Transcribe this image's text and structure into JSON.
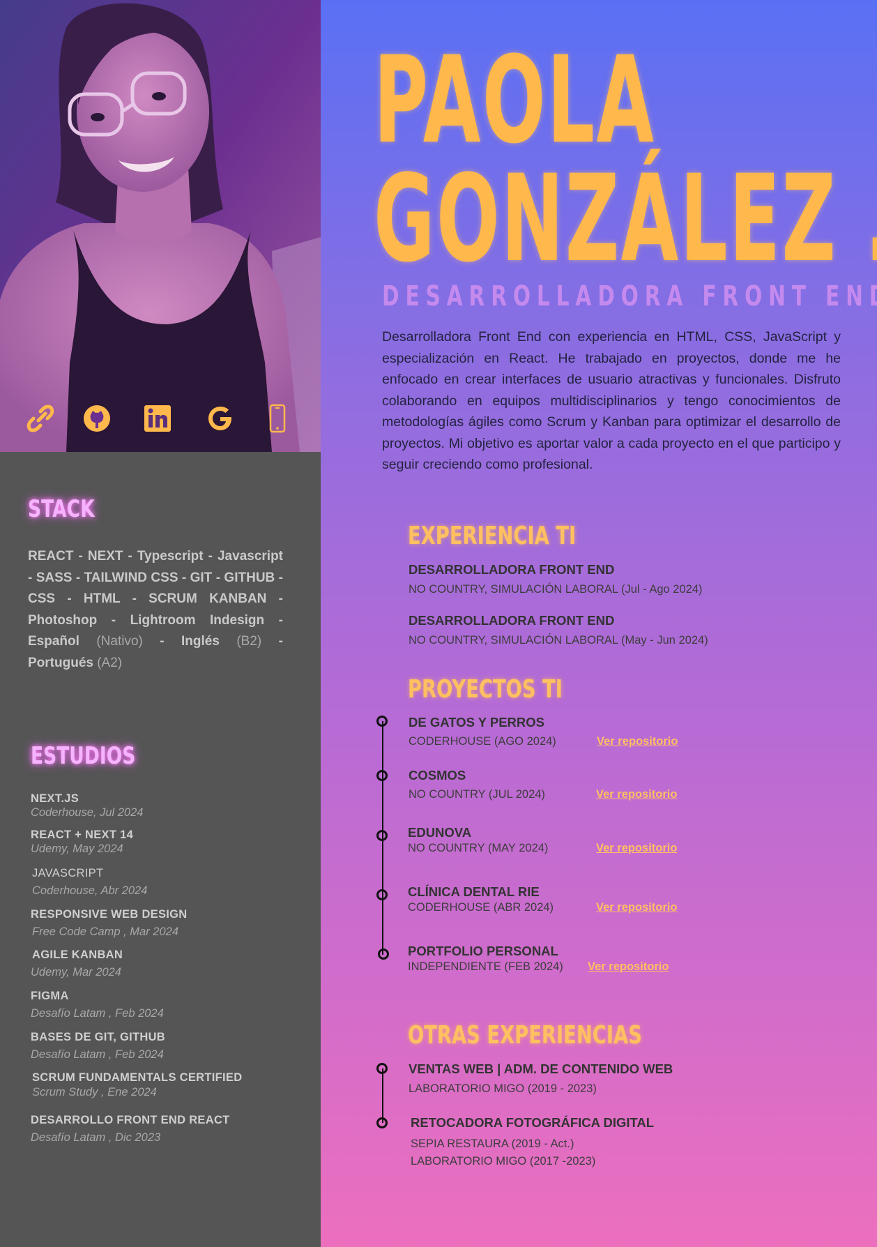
{
  "profile": {
    "first_name": "PAOLA",
    "last_name": "GONZÁLEZ .",
    "role": "DESARROLLADORA FRONT END",
    "summary": "Desarrolladora Front End con experiencia en HTML, CSS, JavaScript y especialización en React. He trabajado en proyectos, donde me he enfocado en crear interfaces de usuario atractivas y funcionales. Disfruto colaborando en equipos multidisciplinarios y tengo conocimientos de metodologías ágiles como Scrum y Kanban para optimizar el desarrollo de proyectos. Mi objetivo es aportar valor a cada proyecto en el que participo y seguir creciendo como profesional."
  },
  "socials": [
    {
      "icon": "link-icon"
    },
    {
      "icon": "github-icon"
    },
    {
      "icon": "linkedin-icon"
    },
    {
      "icon": "google-icon"
    },
    {
      "icon": "phone-icon"
    }
  ],
  "stack": {
    "title": "STACK",
    "parts": [
      {
        "text": "REACT - NEXT - Typescript - Javascript - SASS - TAILWIND CSS - GIT - GITHUB - CSS - HTML - SCRUM KANBAN - Photoshop - Lightroom Indesign - Español ",
        "light": false
      },
      {
        "text": "(Nativo)",
        "light": true
      },
      {
        "text": " - Inglés ",
        "light": false
      },
      {
        "text": "(B2)",
        "light": true
      },
      {
        "text": " - Portugués ",
        "light": false
      },
      {
        "text": "(A2)",
        "light": true
      }
    ]
  },
  "studies": {
    "title": "ESTUDIOS",
    "items": [
      {
        "name": "NEXT.JS",
        "meta": "Coderhouse, Jul 2024"
      },
      {
        "name": "REACT + NEXT 14",
        "meta": "Udemy, May 2024"
      },
      {
        "name": "JAVASCRIPT",
        "meta": "Coderhouse, Abr 2024"
      },
      {
        "name": "RESPONSIVE  WEB DESIGN",
        "meta": "Free Code Camp , Mar 2024"
      },
      {
        "name": "AGILE KANBAN",
        "meta": "Udemy, Mar 2024"
      },
      {
        "name": "FIGMA",
        "meta": "Desafío Latam , Feb 2024"
      },
      {
        "name": "BASES  DE GIT, GITHUB",
        "meta": "Desafío Latam , Feb 2024"
      },
      {
        "name": "SCRUM FUNDAMENTALS CERTIFIED",
        "meta": "Scrum Study , Ene 2024"
      },
      {
        "name": "DESARROLLO FRONT END REACT",
        "meta": "Desafío Latam , Dic 2023"
      }
    ]
  },
  "experience": {
    "title": "EXPERIENCIA TI",
    "items": [
      {
        "title": "DESARROLLADORA FRONT END",
        "sub": "NO COUNTRY, SIMULACIÓN LABORAL (Jul - Ago 2024)"
      },
      {
        "title": "DESARROLLADORA FRONT END",
        "sub": "NO COUNTRY, SIMULACIÓN LABORAL (May - Jun 2024)"
      }
    ]
  },
  "projects": {
    "title": "PROYECTOS TI",
    "link_label": "Ver repositorio",
    "items": [
      {
        "title": "DE GATOS Y PERROS",
        "sub": "CODERHOUSE (AGO 2024)"
      },
      {
        "title": "COSMOS",
        "sub": "NO COUNTRY (JUL 2024)"
      },
      {
        "title": "EDUNOVA",
        "sub": "NO COUNTRY (MAY 2024)"
      },
      {
        "title": "CLÍNICA DENTAL RIE",
        "sub": "CODERHOUSE (ABR 2024)"
      },
      {
        "title": "PORTFOLIO PERSONAL",
        "sub": "INDEPENDIENTE (FEB 2024)"
      }
    ]
  },
  "other": {
    "title": "OTRAS EXPERIENCIAS",
    "items": [
      {
        "title": "VENTAS WEB | ADM. DE CONTENIDO WEB",
        "lines": [
          "LABORATORIO MIGO (2019 - 2023)"
        ]
      },
      {
        "title": "RETOCADORA FOTOGRÁFICA DIGITAL",
        "lines": [
          "SEPIA RESTAURA (2019 - Act.)",
          "LABORATORIO MIGO (2017 -2023)"
        ]
      }
    ]
  },
  "colors": {
    "accent": "#ffb84c",
    "neon_pink": "#f6b3ff",
    "left_bg": "#555555",
    "grad_top": "#5a70f4",
    "grad_bottom": "#ec6fbe"
  }
}
